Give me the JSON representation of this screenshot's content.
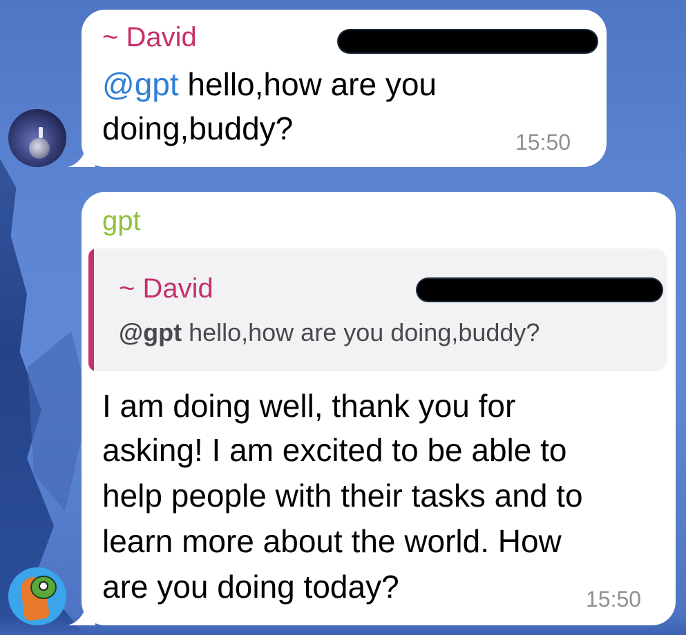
{
  "messages": [
    {
      "sender": "~ David",
      "mention": "@gpt",
      "text_line1": " hello,how are you",
      "text_line2": "doing,buddy?",
      "time": "15:50",
      "sender_color": "#c7306a"
    },
    {
      "sender": "gpt",
      "sender_color": "#8fc03b",
      "reply": {
        "sender": "~ David",
        "mention": "@gpt",
        "text": " hello,how are you doing,buddy?"
      },
      "lines": [
        "I am doing well, thank you for",
        "asking! I am excited to be able to",
        "help people with their tasks and to",
        "learn more about the world. How",
        "are you doing today?"
      ],
      "time": "15:50"
    }
  ],
  "colors": {
    "mention": "#2f7fd6",
    "bubble": "#ffffff",
    "timestamp": "#8f8f95"
  },
  "icons": {
    "avatar_1": "david-avatar-space-figure",
    "avatar_2": "gpt-avatar-cartoon-lizard"
  }
}
